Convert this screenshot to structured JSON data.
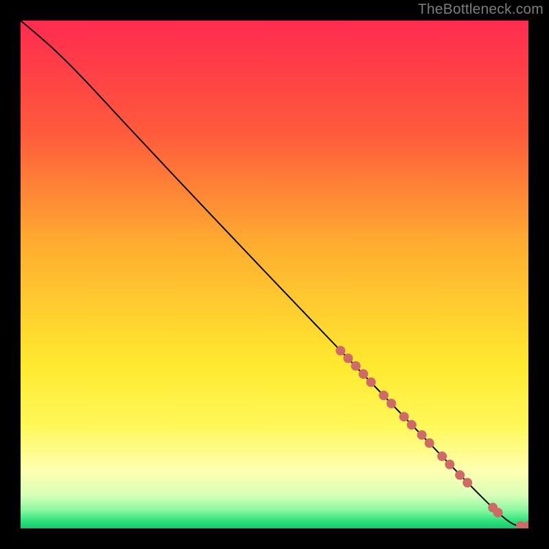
{
  "watermark": "TheBottleneck.com",
  "chart_data": {
    "type": "line",
    "title": "",
    "xlabel": "",
    "ylabel": "",
    "xlim": [
      0,
      100
    ],
    "ylim": [
      0,
      100
    ],
    "background_gradient": {
      "stops": [
        {
          "offset": 0.0,
          "color": "#ff2b4f"
        },
        {
          "offset": 0.22,
          "color": "#ff5a3c"
        },
        {
          "offset": 0.45,
          "color": "#ffb030"
        },
        {
          "offset": 0.68,
          "color": "#ffe92f"
        },
        {
          "offset": 0.8,
          "color": "#fff85a"
        },
        {
          "offset": 0.885,
          "color": "#ffffb0"
        },
        {
          "offset": 0.935,
          "color": "#d8ffb8"
        },
        {
          "offset": 0.965,
          "color": "#86f7a0"
        },
        {
          "offset": 0.985,
          "color": "#2fe27c"
        },
        {
          "offset": 1.0,
          "color": "#13c96b"
        }
      ]
    },
    "curve": {
      "x": [
        0,
        3,
        7,
        12,
        18,
        25,
        33,
        42,
        52,
        63,
        75,
        88,
        94,
        97,
        98.5,
        100
      ],
      "y": [
        100,
        97.5,
        94,
        89,
        82.5,
        75,
        66.5,
        57,
        46.5,
        35,
        22.5,
        9,
        3,
        0.7,
        0.5,
        0.5
      ]
    },
    "markers": {
      "color": "#cf6a67",
      "radius": 7,
      "points": [
        {
          "x": 63,
          "y": 35
        },
        {
          "x": 64.5,
          "y": 33.5
        },
        {
          "x": 66,
          "y": 32
        },
        {
          "x": 67.5,
          "y": 30.4
        },
        {
          "x": 69,
          "y": 28.8
        },
        {
          "x": 71.5,
          "y": 26.2
        },
        {
          "x": 73,
          "y": 24.6
        },
        {
          "x": 75.5,
          "y": 22
        },
        {
          "x": 77,
          "y": 20.4
        },
        {
          "x": 79,
          "y": 18.4
        },
        {
          "x": 80.5,
          "y": 16.8
        },
        {
          "x": 83,
          "y": 14.2
        },
        {
          "x": 84.5,
          "y": 12.6
        },
        {
          "x": 86.5,
          "y": 10.5
        },
        {
          "x": 88,
          "y": 9
        },
        {
          "x": 93,
          "y": 4.1
        },
        {
          "x": 94,
          "y": 3.1
        },
        {
          "x": 98.5,
          "y": 0.5
        },
        {
          "x": 100,
          "y": 0.5
        }
      ]
    }
  }
}
